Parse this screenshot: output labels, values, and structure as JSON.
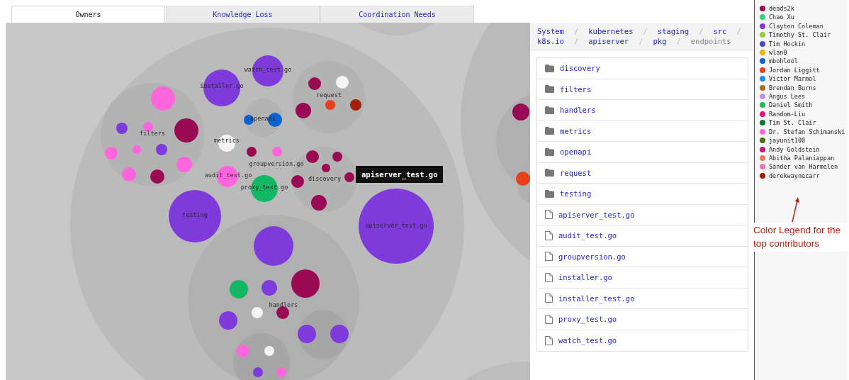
{
  "tabs": [
    {
      "label": "Owners",
      "selected": true
    },
    {
      "label": "Knowledge Loss",
      "selected": false
    },
    {
      "label": "Coordination Needs",
      "selected": false
    }
  ],
  "bubble_chart": {
    "labels": [
      "watch_test.go",
      "installer.go",
      "request",
      "filters",
      "openapi",
      "metrics",
      "groupversion.go",
      "audit_test.go",
      "discovery",
      "proxy_test.go",
      "testing",
      "apiserver_test.go",
      "handlers"
    ],
    "tooltip": "apiserver_test.go"
  },
  "breadcrumb": {
    "separator": "/",
    "items": [
      {
        "label": "System",
        "current": false
      },
      {
        "label": "kubernetes",
        "current": false
      },
      {
        "label": "staging",
        "current": false
      },
      {
        "label": "src",
        "current": false
      },
      {
        "label": "k8s.io",
        "current": false
      },
      {
        "label": "apiserver",
        "current": false
      },
      {
        "label": "pkg",
        "current": false
      },
      {
        "label": "endpoints",
        "current": true
      }
    ]
  },
  "entries": [
    {
      "name": "discovery",
      "kind": "folder"
    },
    {
      "name": "filters",
      "kind": "folder"
    },
    {
      "name": "handlers",
      "kind": "folder"
    },
    {
      "name": "metrics",
      "kind": "folder"
    },
    {
      "name": "openapi",
      "kind": "folder"
    },
    {
      "name": "request",
      "kind": "folder"
    },
    {
      "name": "testing",
      "kind": "folder"
    },
    {
      "name": "apiserver_test.go",
      "kind": "file"
    },
    {
      "name": "audit_test.go",
      "kind": "file"
    },
    {
      "name": "groupversion.go",
      "kind": "file"
    },
    {
      "name": "installer.go",
      "kind": "file"
    },
    {
      "name": "installer_test.go",
      "kind": "file"
    },
    {
      "name": "proxy_test.go",
      "kind": "file"
    },
    {
      "name": "watch_test.go",
      "kind": "file"
    }
  ],
  "legend": [
    {
      "name": "deads2k",
      "color": "#9b0a55"
    },
    {
      "name": "Chao Xu",
      "color": "#2ed47a"
    },
    {
      "name": "Clayton Coleman",
      "color": "#7f3adb"
    },
    {
      "name": "Timothy St. Clair",
      "color": "#9acd32"
    },
    {
      "name": "Tim Hockin",
      "color": "#4b4bc8"
    },
    {
      "name": "wlan0",
      "color": "#f0b400"
    },
    {
      "name": "mbohlool",
      "color": "#0a63d4"
    },
    {
      "name": "Jordan Liggitt",
      "color": "#e8401c"
    },
    {
      "name": "Victor Marmol",
      "color": "#1e90f0"
    },
    {
      "name": "Brendan Burns",
      "color": "#a8701a"
    },
    {
      "name": "Angus Lees",
      "color": "#c490e8"
    },
    {
      "name": "Daniel Smith",
      "color": "#22b866"
    },
    {
      "name": "Random-Liu",
      "color": "#e8147e"
    },
    {
      "name": "Tim St. Clair",
      "color": "#0a7a3a"
    },
    {
      "name": "Dr. Stefan Schimanski",
      "color": "#ff66dd"
    },
    {
      "name": "jayunit100",
      "color": "#4a6e10"
    },
    {
      "name": "Andy Goldstein",
      "color": "#c8186e"
    },
    {
      "name": "Abitha Palaniappan",
      "color": "#f07860"
    },
    {
      "name": "Sander van Harmelen",
      "color": "#f070b0"
    },
    {
      "name": "derekwaynecarr",
      "color": "#a0200a"
    }
  ],
  "annotation": "Color Legend for the top contributors"
}
